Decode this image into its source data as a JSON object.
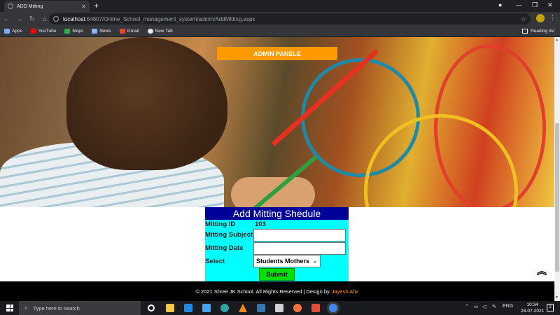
{
  "browser": {
    "tab_title": "ADD Mitting",
    "url_host": "localhost",
    "url_path": ":64607/Online_School_management_system/admin/AddMitting.aspx",
    "bookmarks": [
      {
        "label": "Apps",
        "color": "#7baaf7"
      },
      {
        "label": "YouTube",
        "color": "#ff0000"
      },
      {
        "label": "Maps",
        "color": "#34a853"
      },
      {
        "label": "News",
        "color": "#8ab4f8"
      },
      {
        "label": "Gmail",
        "color": "#ea4335"
      },
      {
        "label": "New Tab",
        "color": "#e8eaed"
      }
    ],
    "reading_list": "Reading list"
  },
  "page": {
    "admin_banner": "ADMIN PANELE",
    "form": {
      "title": "Add Mitting Shedule",
      "id_label": "Mitting ID",
      "id_value": "103",
      "subject_label": "Mitting Subject",
      "subject_value": "",
      "date_label": "Mitting Date",
      "date_value": "",
      "select_label": "Select",
      "select_value": "Students Mothers",
      "submit_label": "Submit"
    },
    "footer": {
      "text": "© 2021 Shree JK School. All Rights Reserved | Design by",
      "author": "Jayesh Ahir"
    },
    "to_top_glyph": "︽"
  },
  "taskbar": {
    "search_placeholder": "Type here to search",
    "lang": "ENG",
    "time": "10:34",
    "date": "28-07-2021",
    "notifications": "2"
  },
  "colors": {
    "banner": "#ff9900",
    "form_bg": "#00ffff",
    "form_title_bg": "#000099",
    "submit_bg": "#00e000",
    "author": "#ff9900"
  }
}
